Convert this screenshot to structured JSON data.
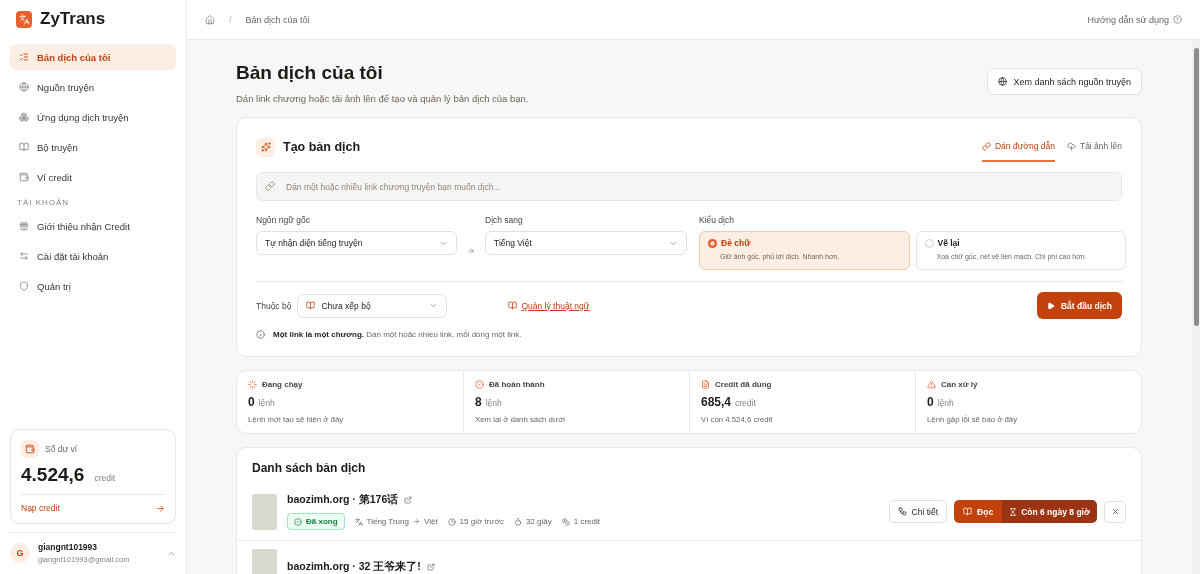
{
  "brand": {
    "name": "ZyTrans"
  },
  "nav": [
    {
      "label": "Bản dịch của tôi",
      "selected": true
    },
    {
      "label": "Nguồn truyện",
      "selected": false
    },
    {
      "label": "Ứng dụng dịch truyện",
      "selected": false
    },
    {
      "label": "Bộ truyện",
      "selected": false
    },
    {
      "label": "Ví credit",
      "selected": false
    }
  ],
  "account_section": {
    "label": "TÀI KHOẢN",
    "items": [
      {
        "label": "Giới thiệu nhận Credit",
        "selected": false
      },
      {
        "label": "Cài đặt tài khoản",
        "selected": false
      },
      {
        "label": "Quản trị",
        "selected": false
      }
    ]
  },
  "wallet": {
    "title": "Số dư ví",
    "amount": "4.524,6",
    "unit": "credit",
    "link": "Nạp credit"
  },
  "user": {
    "initial": "G",
    "name": "giangnt101993",
    "email": "giangnt101993@gmail.com"
  },
  "breadcrumb": {
    "separator": "/",
    "current": "Bản dịch của tôi"
  },
  "help_link": "Hướng dẫn sử dụng",
  "page": {
    "title": "Bản dịch của tôi",
    "subtitle": "Dán link chương hoặc tải ảnh lên để tạo và quản lý bản dịch của bạn.",
    "sources_button": "Xem danh sách nguồn truyện"
  },
  "create": {
    "title": "Tạo bản dịch",
    "tabs": [
      {
        "label": "Dán đường dẫn",
        "selected": true
      },
      {
        "label": "Tải ảnh lên",
        "selected": false
      }
    ],
    "link_input": {
      "placeholder": "Dán một hoặc nhiều link chương truyện bạn muốn dịch..."
    },
    "source_language": {
      "label": "Ngôn ngữ gốc",
      "value": "Tự nhận diện tiếng truyện"
    },
    "target_language": {
      "label": "Dịch sang",
      "value": "Tiếng Việt"
    },
    "mode": {
      "label": "Kiểu dịch",
      "options": [
        {
          "title": "Đè chữ",
          "description": "Giữ ảnh gốc, phủ lời dịch. Nhanh hơn.",
          "selected": true
        },
        {
          "title": "Vẽ lại",
          "description": "Xoá chữ gốc, nét vẽ liền mạch. Chi phí cao hơn.",
          "selected": false
        }
      ]
    },
    "series": {
      "label": "Thuộc bộ",
      "value": "Chưa xếp bộ"
    },
    "glossary_link": "Quản lý thuật ngữ",
    "start_button": "Bắt đầu dịch",
    "hint": "**Một link là một chương.** Dán một hoặc nhiều link, mỗi dòng một link."
  },
  "stats": [
    {
      "label": "Đang chạy",
      "value": "0",
      "unit": "lệnh",
      "note": "Lệnh mới tạo sẽ hiện ở đây"
    },
    {
      "label": "Đã hoàn thành",
      "value": "8",
      "unit": "lệnh",
      "note": "Xem lại ở danh sách dưới"
    },
    {
      "label": "Credit đã dùng",
      "value": "685,4",
      "unit": "credit",
      "note": "Ví còn 4.524,6 credit"
    },
    {
      "label": "Cần xử lý",
      "value": "0",
      "unit": "lệnh",
      "note": "Lệnh gặp lỗi sẽ báo ở đây"
    }
  ],
  "list": {
    "title": "Danh sách bản dịch",
    "rows": [
      {
        "title": "baozimh.org · 第176话",
        "status": "Đã xong",
        "source_lang": "Tiếng Trung",
        "target_lang": "Việt",
        "time": "15 giờ trước",
        "duration": "32 giây",
        "cost": "1 credit",
        "details_button": "Chi tiết",
        "read_button": "Đọc",
        "expiry": "Còn 6 ngày 8 giờ"
      },
      {
        "title": "baozimh.org · 32 王爷来了!"
      }
    ]
  }
}
